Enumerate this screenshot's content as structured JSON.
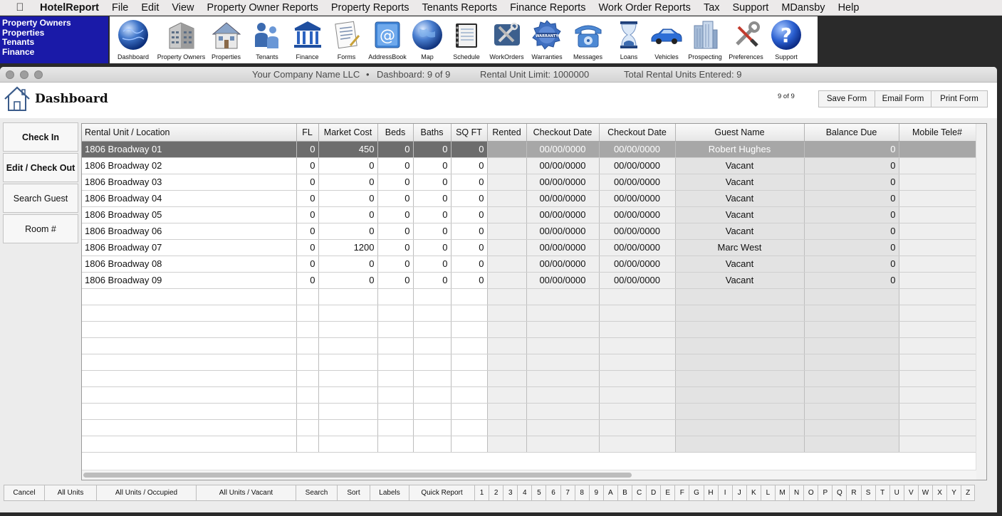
{
  "menubar": {
    "app_name": "HotelReport",
    "items": [
      "File",
      "Edit",
      "View",
      "Property Owner Reports",
      "Property Reports",
      "Tenants Reports",
      "Finance Reports",
      "Work Order Reports",
      "Tax",
      "Support",
      "MDansby",
      "Help"
    ]
  },
  "quicknav": [
    "Property Owners",
    "Properties",
    "Tenants",
    "Finance"
  ],
  "toolbar": [
    {
      "label": "Dashboard",
      "icon": "globe-icon"
    },
    {
      "label": "Property Owners",
      "icon": "building-icon"
    },
    {
      "label": "Properties",
      "icon": "house-icon"
    },
    {
      "label": "Tenants",
      "icon": "people-icon"
    },
    {
      "label": "Finance",
      "icon": "bank-icon"
    },
    {
      "label": "Forms",
      "icon": "document-icon"
    },
    {
      "label": "AddressBook",
      "icon": "at-sign-icon"
    },
    {
      "label": "Map",
      "icon": "map-globe-icon"
    },
    {
      "label": "Schedule",
      "icon": "notebook-icon"
    },
    {
      "label": "WorkOrders",
      "icon": "tools-icon"
    },
    {
      "label": "Warranties",
      "icon": "warranty-badge-icon"
    },
    {
      "label": "Messages",
      "icon": "telephone-icon"
    },
    {
      "label": "Loans",
      "icon": "hourglass-icon"
    },
    {
      "label": "Vehicles",
      "icon": "car-icon"
    },
    {
      "label": "Prospecting",
      "icon": "skyscraper-icon"
    },
    {
      "label": "Preferences",
      "icon": "wrench-screwdriver-icon"
    },
    {
      "label": "Support",
      "icon": "help-icon"
    }
  ],
  "window": {
    "company": "Your Company Name LLC",
    "separator": "•",
    "dashboard_count": "Dashboard: 9 of 9",
    "unit_limit": "Rental Unit Limit: 1000000",
    "units_entered": "Total Rental Units Entered: 9"
  },
  "header": {
    "title": "Dashboard",
    "pager": "9  of  9",
    "save_label": "Save Form",
    "email_label": "Email Form",
    "print_label": "Print Form"
  },
  "side_buttons": [
    "Check In",
    "Edit / Check Out",
    "Search Guest",
    "Room #"
  ],
  "table": {
    "columns": [
      "Rental Unit / Location",
      "FL",
      "Market Cost",
      "Beds",
      "Baths",
      "SQ FT",
      "Rented",
      "Checkout Date",
      "Checkout Date",
      "Guest Name",
      "Balance Due",
      "Mobile Tele#"
    ],
    "rows": [
      [
        "1806 Broadway 01",
        "0",
        "450",
        "0",
        "0",
        "0",
        "",
        "00/00/0000",
        "00/00/0000",
        "Robert Hughes",
        "0",
        ""
      ],
      [
        "1806 Broadway 02",
        "0",
        "0",
        "0",
        "0",
        "0",
        "",
        "00/00/0000",
        "00/00/0000",
        "Vacant",
        "0",
        ""
      ],
      [
        "1806 Broadway 03",
        "0",
        "0",
        "0",
        "0",
        "0",
        "",
        "00/00/0000",
        "00/00/0000",
        "Vacant",
        "0",
        ""
      ],
      [
        "1806 Broadway 04",
        "0",
        "0",
        "0",
        "0",
        "0",
        "",
        "00/00/0000",
        "00/00/0000",
        "Vacant",
        "0",
        ""
      ],
      [
        "1806 Broadway 05",
        "0",
        "0",
        "0",
        "0",
        "0",
        "",
        "00/00/0000",
        "00/00/0000",
        "Vacant",
        "0",
        ""
      ],
      [
        "1806 Broadway 06",
        "0",
        "0",
        "0",
        "0",
        "0",
        "",
        "00/00/0000",
        "00/00/0000",
        "Vacant",
        "0",
        ""
      ],
      [
        "1806 Broadway 07",
        "0",
        "1200",
        "0",
        "0",
        "0",
        "",
        "00/00/0000",
        "00/00/0000",
        "Marc West",
        "0",
        ""
      ],
      [
        "1806 Broadway 08",
        "0",
        "0",
        "0",
        "0",
        "0",
        "",
        "00/00/0000",
        "00/00/0000",
        "Vacant",
        "0",
        ""
      ],
      [
        "1806 Broadway 09",
        "0",
        "0",
        "0",
        "0",
        "0",
        "",
        "00/00/0000",
        "00/00/0000",
        "Vacant",
        "0",
        ""
      ]
    ],
    "selected_row": 0
  },
  "bottom_buttons": [
    "Cancel",
    "All Units",
    "All Units / Occupied",
    "All Units / Vacant",
    "Search",
    "Sort",
    "Labels",
    "Quick Report"
  ],
  "letters": [
    "1",
    "2",
    "3",
    "4",
    "5",
    "6",
    "7",
    "8",
    "9",
    "A",
    "B",
    "C",
    "D",
    "E",
    "F",
    "G",
    "H",
    "I",
    "J",
    "K",
    "L",
    "M",
    "N",
    "O",
    "P",
    "Q",
    "R",
    "S",
    "T",
    "U",
    "V",
    "W",
    "X",
    "Y",
    "Z"
  ],
  "colors": {
    "nav_blue": "#1a1aa8",
    "selected_row": "#6d6d6d",
    "selected_row_light": "#a7a7a7"
  }
}
